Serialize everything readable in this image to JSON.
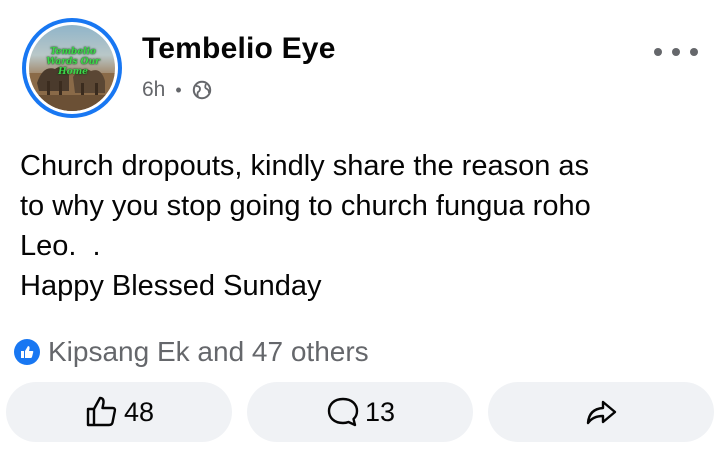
{
  "post": {
    "author": "Tembelio Eye",
    "time": "6h",
    "separator": "•",
    "avatar_caption": "Tembelio Wards Our Home",
    "text_lines": [
      "Church dropouts, kindly share the reason as",
      "to why you stop going to church fungua roho",
      "Leo.  .",
      "Happy Blessed Sunday"
    ],
    "reactions_text": "Kipsang Ek and 47 others",
    "like_count": "48",
    "comment_count": "13"
  },
  "icons": {
    "privacy": "globe-icon",
    "menu": "more-dots-icon",
    "like": "thumbs-up-icon",
    "comment": "comment-bubble-icon",
    "share": "share-arrow-icon"
  },
  "colors": {
    "accent": "#1877f2",
    "secondary_text": "#65676b",
    "button_bg": "#f0f2f5"
  }
}
